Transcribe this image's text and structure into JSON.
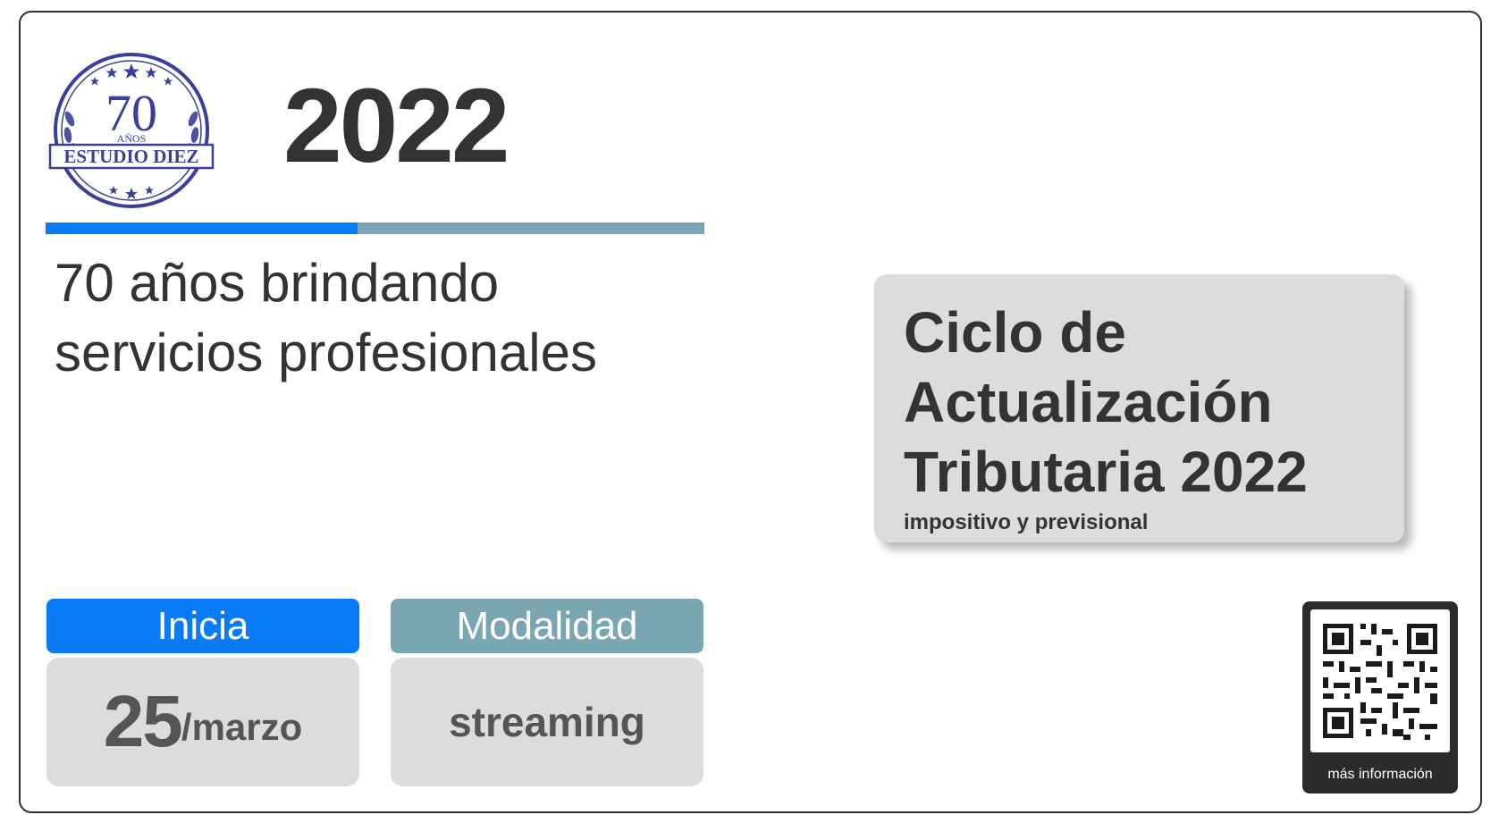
{
  "logo": {
    "number": "70",
    "years_word": "AÑOS",
    "name": "ESTUDIO DIEZ",
    "color": "#3a3f9a"
  },
  "header": {
    "year": "2022"
  },
  "tagline": {
    "line1": "70 años brindando",
    "line2": "servicios profesionales"
  },
  "event": {
    "title_line1": "Ciclo de",
    "title_line2": "Actualización",
    "title_line3": "Tributaria 2022",
    "subtitle": "impositivo y previsional"
  },
  "start": {
    "label": "Inicia",
    "day": "25",
    "month": "/marzo"
  },
  "mode": {
    "label": "Modalidad",
    "value": "streaming"
  },
  "qr": {
    "label": "más información",
    "icon": "qr-code-icon"
  },
  "colors": {
    "accent_blue": "#0a7bf6",
    "accent_teal": "#79a6b0",
    "text": "#333333",
    "card_bg": "#dcdcdc"
  }
}
